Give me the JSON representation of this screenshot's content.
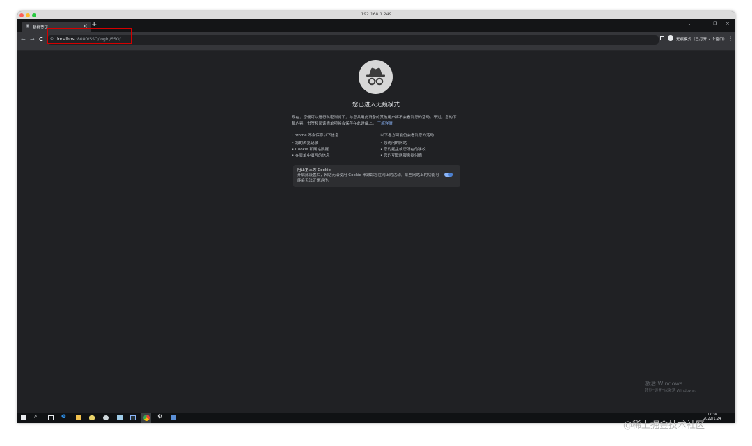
{
  "mac_window": {
    "title": "192.168.1.249"
  },
  "browser": {
    "tab_title": "新标签页",
    "tab_close": "×",
    "new_tab": "+",
    "window_controls": [
      "⌄",
      "–",
      "❐",
      "×"
    ],
    "nav": {
      "back": "←",
      "forward": "→",
      "reload": "C"
    },
    "url_host": "localhost",
    "url_rest": ":8080/SSO/login/SSO/",
    "profile_label": "无痕模式（已打开 2 个窗口）",
    "menu": "⋮"
  },
  "incognito": {
    "heading": "您已进入无痕模式",
    "intro": "现在，您便可以进行私密浏览了，与您共用此设备的其他用户将不会看到您的活动。不过，您的下载内容、书签和阅读清单项将会保存在此设备上。",
    "learn_more": "了解详情",
    "left_col": {
      "heading": "Chrome 不会保存以下信息：",
      "items": [
        "您的浏览记录",
        "Cookie 和网站数据",
        "在表单中填写的信息"
      ]
    },
    "right_col": {
      "heading": "以下各方可能仍会看到您的活动：",
      "items": [
        "您访问的网站",
        "您的雇主或您所在的学校",
        "您的互联网服务提供商"
      ]
    },
    "cookie_card": {
      "title": "阻止第三方 Cookie",
      "desc": "开启此设置后，网站无法使用 Cookie 来跟踪您在网上的活动。某些网站上的功能可能会无法正常运作。",
      "enabled": true
    }
  },
  "activation": {
    "title": "激活 Windows",
    "subtitle": "转到“设置”以激活 Windows。"
  },
  "taskbar": {
    "time": "17:38",
    "date": "2022/1/24"
  },
  "watermark": "@稀土掘金技术社区",
  "colors": {
    "page_bg": "#202124",
    "link": "#8ab4f8",
    "highlight_box": "#d50000"
  }
}
